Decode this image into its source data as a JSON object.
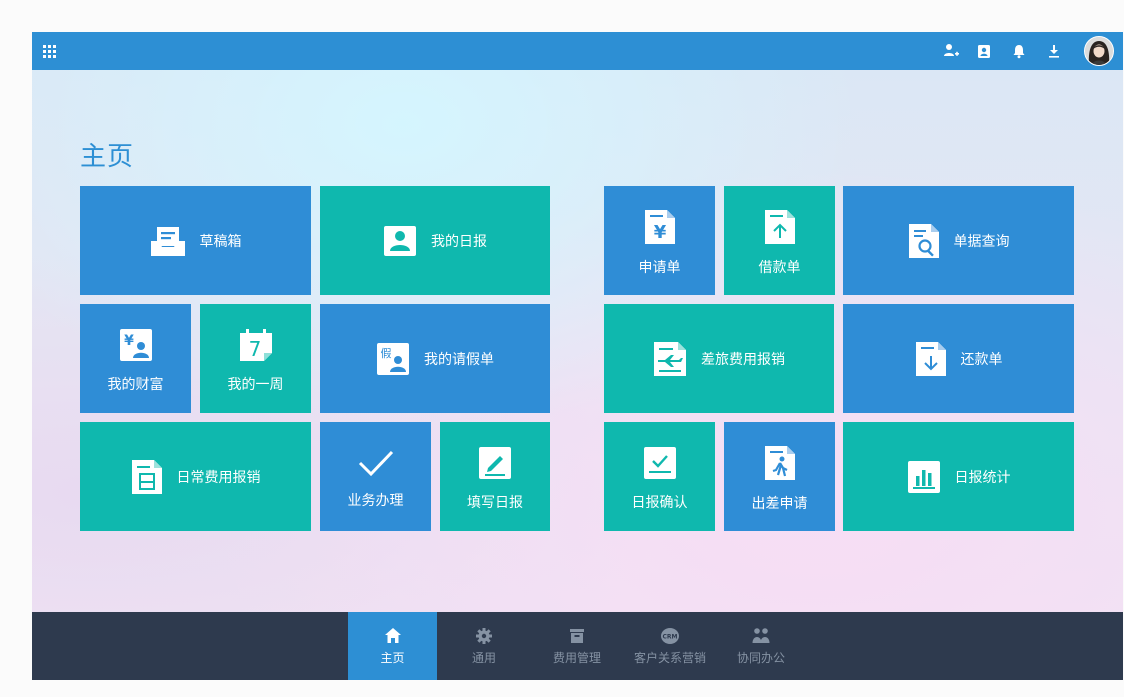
{
  "colors": {
    "brand_blue": "#2d8fd4",
    "tile_blue": "#2f8dd6",
    "tile_teal": "#0fb8ae",
    "bottom_bar": "#2e3a4e"
  },
  "page": {
    "title": "主页"
  },
  "tiles": {
    "drafts": "草稿箱",
    "my_daily_report": "我的日报",
    "application": "申请单",
    "loan": "借款单",
    "document_query": "单据查询",
    "my_wealth": "我的财富",
    "my_week": "我的一周",
    "week_icon_number": "7",
    "my_leave": "我的请假单",
    "leave_icon_char": "假",
    "travel_expense": "差旅费用报销",
    "repayment": "还款单",
    "daily_expense": "日常费用报销",
    "business": "业务办理",
    "fill_daily_report": "填写日报",
    "daily_report_confirm": "日报确认",
    "business_trip": "出差申请",
    "daily_report_stats": "日报统计"
  },
  "bottom_nav": {
    "home": "主页",
    "general": "通用",
    "expense_mgmt": "费用管理",
    "crm": "客户关系营销",
    "crm_icon_text": "CRM",
    "collab": "协同办公"
  }
}
